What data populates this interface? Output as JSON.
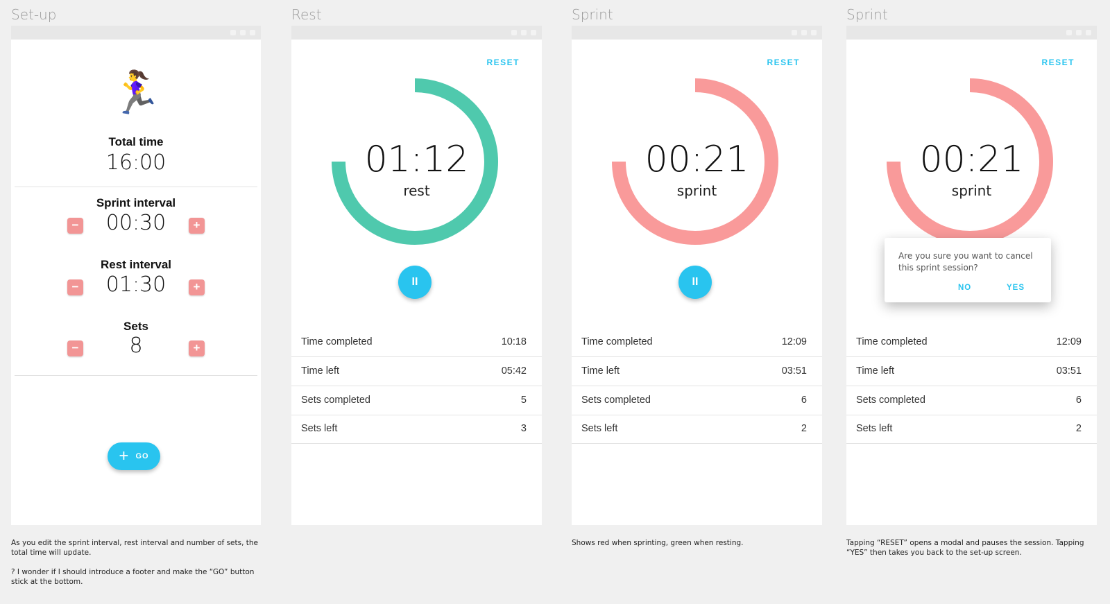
{
  "columns": [
    "Set-up",
    "Rest",
    "Sprint",
    "Sprint"
  ],
  "colors": {
    "rest": "#4fc9ad",
    "sprint": "#f99a9a",
    "accent": "#29c4ef",
    "stepper": "#f29595"
  },
  "setup": {
    "runner_icon": "🏃‍♀️",
    "total_label": "Total time",
    "total_value": "16:00",
    "sprint_label": "Sprint interval",
    "sprint_value": "00:30",
    "rest_label": "Rest interval",
    "rest_value": "01:30",
    "sets_label": "Sets",
    "sets_value": "8",
    "minus": "−",
    "plus": "+",
    "go_plus": "+",
    "go_label": "GO"
  },
  "rest_screen": {
    "reset": "RESET",
    "time": "01:12",
    "mode": "rest",
    "pause": "II",
    "progress_fraction": 0.75,
    "stats": [
      {
        "label": "Time completed",
        "value": "10:18"
      },
      {
        "label": "Time left",
        "value": "05:42"
      },
      {
        "label": "Sets completed",
        "value": "5"
      },
      {
        "label": "Sets left",
        "value": "3"
      }
    ]
  },
  "sprint_screen": {
    "reset": "RESET",
    "time": "00:21",
    "mode": "sprint",
    "pause": "II",
    "progress_fraction": 0.75,
    "stats": [
      {
        "label": "Time completed",
        "value": "12:09"
      },
      {
        "label": "Time left",
        "value": "03:51"
      },
      {
        "label": "Sets completed",
        "value": "6"
      },
      {
        "label": "Sets left",
        "value": "2"
      }
    ]
  },
  "modal_screen": {
    "reset": "RESET",
    "time": "00:21",
    "mode": "sprint",
    "progress_fraction": 0.75,
    "modal_message": "Are you sure you want to cancel this sprint session?",
    "no": "NO",
    "yes": "YES",
    "stats": [
      {
        "label": "Time completed",
        "value": "12:09"
      },
      {
        "label": "Time left",
        "value": "03:51"
      },
      {
        "label": "Sets completed",
        "value": "6"
      },
      {
        "label": "Sets left",
        "value": "2"
      }
    ]
  },
  "notes": {
    "setup_1": "As you edit the sprint interval, rest interval and number of sets, the total time will update.",
    "setup_2": "? I wonder if I should introduce a footer and make the “GO” button stick at the bottom.",
    "sprint": "Shows red when sprinting, green when resting.",
    "modal": "Tapping “RESET” opens a modal and pauses the session. Tapping “YES” then takes you back to the set-up screen."
  }
}
